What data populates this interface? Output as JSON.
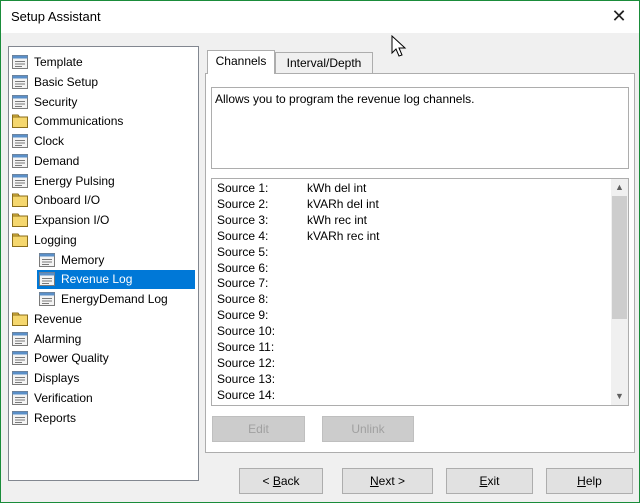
{
  "window": {
    "title": "Setup Assistant",
    "close_glyph": "✕"
  },
  "tree": {
    "items": [
      {
        "label": "Template",
        "icon": "doc-icon",
        "indent": 0
      },
      {
        "label": "Basic Setup",
        "icon": "doc-icon",
        "indent": 0
      },
      {
        "label": "Security",
        "icon": "doc-icon",
        "indent": 0
      },
      {
        "label": "Communications",
        "icon": "folder-icon",
        "indent": 0
      },
      {
        "label": "Clock",
        "icon": "doc-icon",
        "indent": 0
      },
      {
        "label": "Demand",
        "icon": "doc-icon",
        "indent": 0
      },
      {
        "label": "Energy Pulsing",
        "icon": "doc-icon",
        "indent": 0
      },
      {
        "label": "Onboard I/O",
        "icon": "folder-icon",
        "indent": 0
      },
      {
        "label": "Expansion I/O",
        "icon": "folder-icon",
        "indent": 0
      },
      {
        "label": "Logging",
        "icon": "folder-icon",
        "indent": 0
      },
      {
        "label": "Memory",
        "icon": "doc-icon",
        "indent": 1
      },
      {
        "label": "Revenue Log",
        "icon": "doc-icon",
        "indent": 1,
        "selected": true
      },
      {
        "label": "EnergyDemand Log",
        "icon": "doc-icon",
        "indent": 1
      },
      {
        "label": "Revenue",
        "icon": "folder-icon",
        "indent": 0
      },
      {
        "label": "Alarming",
        "icon": "doc-icon",
        "indent": 0
      },
      {
        "label": "Power Quality",
        "icon": "doc-icon",
        "indent": 0
      },
      {
        "label": "Displays",
        "icon": "doc-icon",
        "indent": 0
      },
      {
        "label": "Verification",
        "icon": "doc-icon",
        "indent": 0
      },
      {
        "label": "Reports",
        "icon": "doc-icon",
        "indent": 0
      }
    ]
  },
  "tabs": [
    {
      "label": "Channels",
      "active": true
    },
    {
      "label": "Interval/Depth",
      "active": false
    }
  ],
  "description": "Allows you to program the revenue log channels.",
  "sources": [
    {
      "label": "Source 1:",
      "value": "kWh del int"
    },
    {
      "label": "Source 2:",
      "value": "kVARh del int"
    },
    {
      "label": "Source 3:",
      "value": "kWh rec int"
    },
    {
      "label": "Source 4:",
      "value": "kVARh rec int"
    },
    {
      "label": "Source 5:",
      "value": ""
    },
    {
      "label": "Source 6:",
      "value": ""
    },
    {
      "label": "Source 7:",
      "value": ""
    },
    {
      "label": "Source 8:",
      "value": ""
    },
    {
      "label": "Source 9:",
      "value": ""
    },
    {
      "label": "Source 10:",
      "value": ""
    },
    {
      "label": "Source 11:",
      "value": ""
    },
    {
      "label": "Source 12:",
      "value": ""
    },
    {
      "label": "Source 13:",
      "value": ""
    },
    {
      "label": "Source 14:",
      "value": ""
    }
  ],
  "scroll": {
    "up_glyph": "▲",
    "down_glyph": "▼"
  },
  "buttons": {
    "edit": "Edit",
    "unlink": "Unlink",
    "back": {
      "prefix": "< ",
      "mnemonic": "B",
      "rest": "ack"
    },
    "next": {
      "mnemonic": "N",
      "rest": "ext >"
    },
    "exit": {
      "mnemonic": "E",
      "rest": "xit"
    },
    "help": {
      "mnemonic": "H",
      "rest": "elp"
    }
  }
}
